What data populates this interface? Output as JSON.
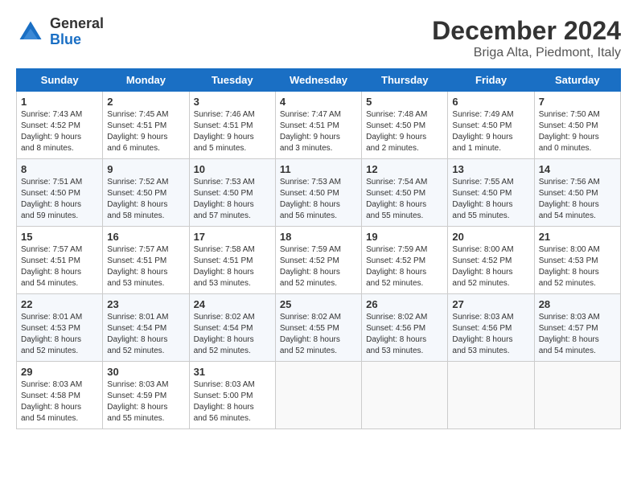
{
  "logo": {
    "general": "General",
    "blue": "Blue"
  },
  "title": {
    "month": "December 2024",
    "location": "Briga Alta, Piedmont, Italy"
  },
  "headers": [
    "Sunday",
    "Monday",
    "Tuesday",
    "Wednesday",
    "Thursday",
    "Friday",
    "Saturday"
  ],
  "weeks": [
    [
      {
        "day": "1",
        "info": "Sunrise: 7:43 AM\nSunset: 4:52 PM\nDaylight: 9 hours\nand 8 minutes."
      },
      {
        "day": "2",
        "info": "Sunrise: 7:45 AM\nSunset: 4:51 PM\nDaylight: 9 hours\nand 6 minutes."
      },
      {
        "day": "3",
        "info": "Sunrise: 7:46 AM\nSunset: 4:51 PM\nDaylight: 9 hours\nand 5 minutes."
      },
      {
        "day": "4",
        "info": "Sunrise: 7:47 AM\nSunset: 4:51 PM\nDaylight: 9 hours\nand 3 minutes."
      },
      {
        "day": "5",
        "info": "Sunrise: 7:48 AM\nSunset: 4:50 PM\nDaylight: 9 hours\nand 2 minutes."
      },
      {
        "day": "6",
        "info": "Sunrise: 7:49 AM\nSunset: 4:50 PM\nDaylight: 9 hours\nand 1 minute."
      },
      {
        "day": "7",
        "info": "Sunrise: 7:50 AM\nSunset: 4:50 PM\nDaylight: 9 hours\nand 0 minutes."
      }
    ],
    [
      {
        "day": "8",
        "info": "Sunrise: 7:51 AM\nSunset: 4:50 PM\nDaylight: 8 hours\nand 59 minutes."
      },
      {
        "day": "9",
        "info": "Sunrise: 7:52 AM\nSunset: 4:50 PM\nDaylight: 8 hours\nand 58 minutes."
      },
      {
        "day": "10",
        "info": "Sunrise: 7:53 AM\nSunset: 4:50 PM\nDaylight: 8 hours\nand 57 minutes."
      },
      {
        "day": "11",
        "info": "Sunrise: 7:53 AM\nSunset: 4:50 PM\nDaylight: 8 hours\nand 56 minutes."
      },
      {
        "day": "12",
        "info": "Sunrise: 7:54 AM\nSunset: 4:50 PM\nDaylight: 8 hours\nand 55 minutes."
      },
      {
        "day": "13",
        "info": "Sunrise: 7:55 AM\nSunset: 4:50 PM\nDaylight: 8 hours\nand 55 minutes."
      },
      {
        "day": "14",
        "info": "Sunrise: 7:56 AM\nSunset: 4:50 PM\nDaylight: 8 hours\nand 54 minutes."
      }
    ],
    [
      {
        "day": "15",
        "info": "Sunrise: 7:57 AM\nSunset: 4:51 PM\nDaylight: 8 hours\nand 54 minutes."
      },
      {
        "day": "16",
        "info": "Sunrise: 7:57 AM\nSunset: 4:51 PM\nDaylight: 8 hours\nand 53 minutes."
      },
      {
        "day": "17",
        "info": "Sunrise: 7:58 AM\nSunset: 4:51 PM\nDaylight: 8 hours\nand 53 minutes."
      },
      {
        "day": "18",
        "info": "Sunrise: 7:59 AM\nSunset: 4:52 PM\nDaylight: 8 hours\nand 52 minutes."
      },
      {
        "day": "19",
        "info": "Sunrise: 7:59 AM\nSunset: 4:52 PM\nDaylight: 8 hours\nand 52 minutes."
      },
      {
        "day": "20",
        "info": "Sunrise: 8:00 AM\nSunset: 4:52 PM\nDaylight: 8 hours\nand 52 minutes."
      },
      {
        "day": "21",
        "info": "Sunrise: 8:00 AM\nSunset: 4:53 PM\nDaylight: 8 hours\nand 52 minutes."
      }
    ],
    [
      {
        "day": "22",
        "info": "Sunrise: 8:01 AM\nSunset: 4:53 PM\nDaylight: 8 hours\nand 52 minutes."
      },
      {
        "day": "23",
        "info": "Sunrise: 8:01 AM\nSunset: 4:54 PM\nDaylight: 8 hours\nand 52 minutes."
      },
      {
        "day": "24",
        "info": "Sunrise: 8:02 AM\nSunset: 4:54 PM\nDaylight: 8 hours\nand 52 minutes."
      },
      {
        "day": "25",
        "info": "Sunrise: 8:02 AM\nSunset: 4:55 PM\nDaylight: 8 hours\nand 52 minutes."
      },
      {
        "day": "26",
        "info": "Sunrise: 8:02 AM\nSunset: 4:56 PM\nDaylight: 8 hours\nand 53 minutes."
      },
      {
        "day": "27",
        "info": "Sunrise: 8:03 AM\nSunset: 4:56 PM\nDaylight: 8 hours\nand 53 minutes."
      },
      {
        "day": "28",
        "info": "Sunrise: 8:03 AM\nSunset: 4:57 PM\nDaylight: 8 hours\nand 54 minutes."
      }
    ],
    [
      {
        "day": "29",
        "info": "Sunrise: 8:03 AM\nSunset: 4:58 PM\nDaylight: 8 hours\nand 54 minutes."
      },
      {
        "day": "30",
        "info": "Sunrise: 8:03 AM\nSunset: 4:59 PM\nDaylight: 8 hours\nand 55 minutes."
      },
      {
        "day": "31",
        "info": "Sunrise: 8:03 AM\nSunset: 5:00 PM\nDaylight: 8 hours\nand 56 minutes."
      },
      {
        "day": "",
        "info": ""
      },
      {
        "day": "",
        "info": ""
      },
      {
        "day": "",
        "info": ""
      },
      {
        "day": "",
        "info": ""
      }
    ]
  ]
}
